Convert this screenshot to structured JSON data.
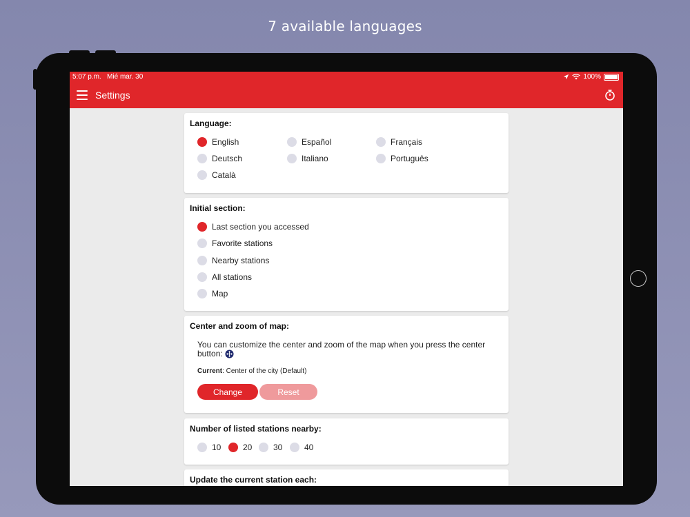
{
  "caption": "7 available languages",
  "status": {
    "time": "5:07 p.m.",
    "date": "Mié mar. 30",
    "battery": "100%"
  },
  "nav": {
    "title": "Settings"
  },
  "language": {
    "title": "Language:",
    "options": [
      "English",
      "Español",
      "Français",
      "Deutsch",
      "Italiano",
      "Português",
      "Català"
    ],
    "selected": "English"
  },
  "initial_section": {
    "title": "Initial section:",
    "options": [
      "Last section you accessed",
      "Favorite stations",
      "Nearby stations",
      "All stations",
      "Map"
    ],
    "selected": "Last section you accessed"
  },
  "map_center": {
    "title": "Center and zoom of map:",
    "description": "You can customize the center and zoom of the map when you press the center button:",
    "current_label": "Current",
    "current_value": ": Center of the city (Default)",
    "change_label": "Change",
    "reset_label": "Reset"
  },
  "nearby_count": {
    "title": "Number of listed stations nearby:",
    "options": [
      "10",
      "20",
      "30",
      "40"
    ],
    "selected": "20"
  },
  "update_station": {
    "title": "Update the current station each:"
  },
  "colors": {
    "accent": "#e0262a",
    "radio_off": "#dcdce6",
    "reset_disabled": "#ef9a9c"
  },
  "icons": [
    "menu-icon",
    "timer-icon",
    "location-arrow-icon",
    "wifi-icon",
    "battery-icon",
    "center-map-icon"
  ]
}
